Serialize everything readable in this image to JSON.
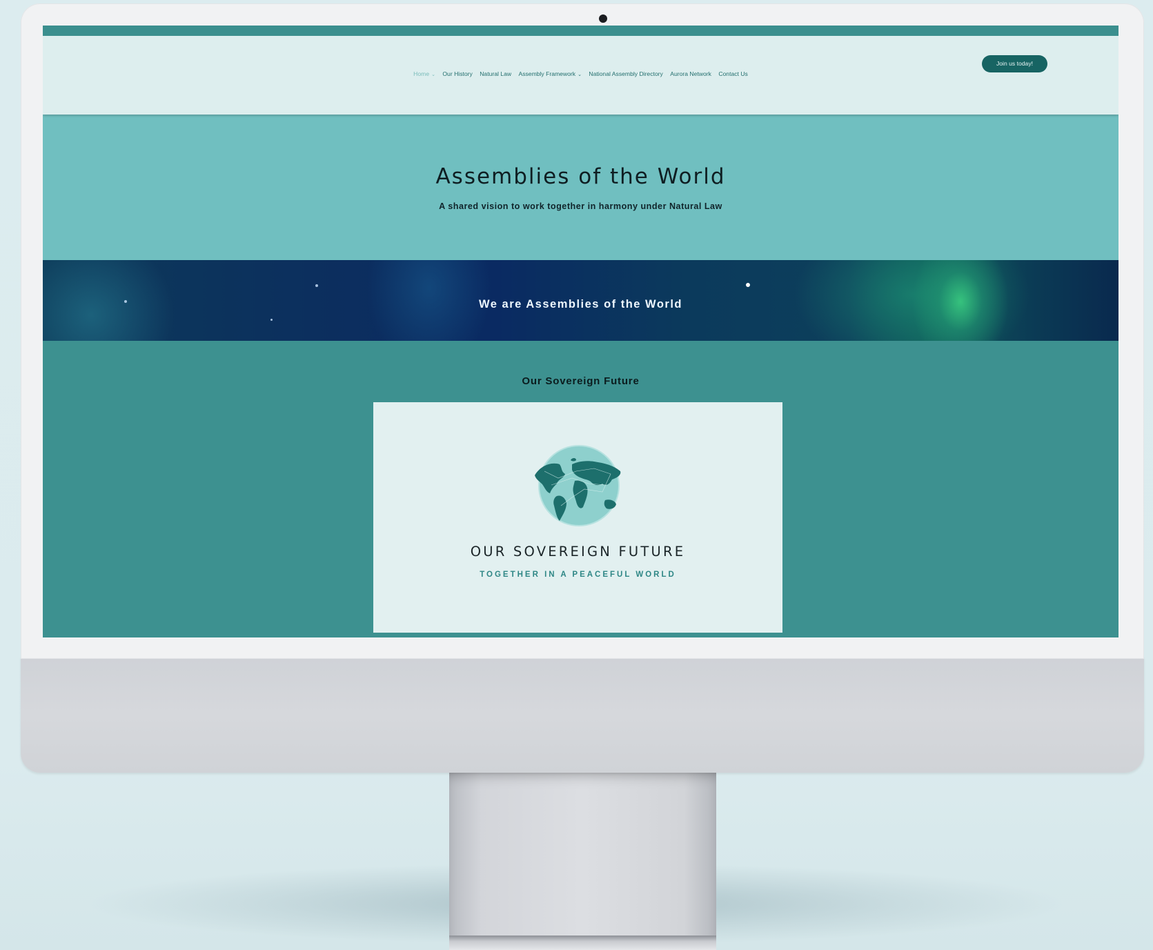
{
  "nav": {
    "items": [
      {
        "label": "Home",
        "caret": "⌄",
        "active": true
      },
      {
        "label": "Our History"
      },
      {
        "label": "Natural Law"
      },
      {
        "label": "Assembly Framework",
        "caret": "⌄"
      },
      {
        "label": "National Assembly Directory"
      },
      {
        "label": "Aurora Network"
      },
      {
        "label": "Contact Us"
      }
    ],
    "cta_label": "Join us today!"
  },
  "hero": {
    "title": "Assemblies of the World",
    "subtitle": "A shared vision to work together in harmony under Natural Law"
  },
  "banner": {
    "text": "We are Assemblies of the World"
  },
  "section": {
    "title": "Our Sovereign Future",
    "card": {
      "icon": "globe-icon",
      "title": "OUR SOVEREIGN FUTURE",
      "subtitle": "TOGETHER IN A PEACEFUL WORLD"
    }
  },
  "colors": {
    "header_bg": "#ddeeee",
    "hero_bg": "#70bfc0",
    "section_bg": "#3d9190",
    "cta_bg": "#176463",
    "card_bg": "#e2f0f0"
  }
}
